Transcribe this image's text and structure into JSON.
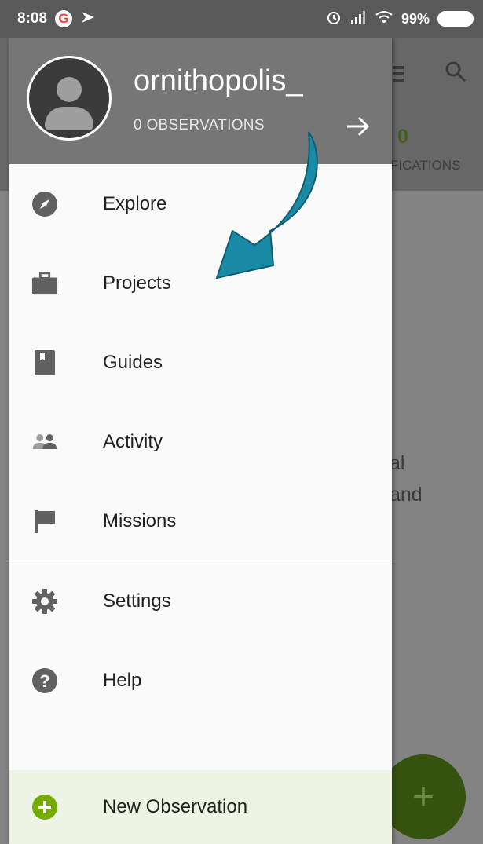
{
  "status_bar": {
    "time": "8:08",
    "g_badge": "G",
    "battery_pct": "99%"
  },
  "header": {
    "username": "ornithopolis_",
    "observations": "0 OBSERVATIONS"
  },
  "menu": [
    {
      "label": "Explore",
      "icon": "compass-icon"
    },
    {
      "label": "Projects",
      "icon": "briefcase-icon"
    },
    {
      "label": "Guides",
      "icon": "book-icon"
    },
    {
      "label": "Activity",
      "icon": "people-icon"
    },
    {
      "label": "Missions",
      "icon": "flag-icon"
    },
    {
      "label": "Settings",
      "icon": "gear-icon"
    },
    {
      "label": "Help",
      "icon": "help-icon"
    }
  ],
  "new_observation": {
    "label": "New Observation",
    "icon": "add-circle-icon"
  },
  "background": {
    "count": "0",
    "tab_label": "FICATIONS",
    "text_line1": "al",
    "text_line2": "and",
    "fab_symbol": "+"
  },
  "colors": {
    "accent_green": "#74ac00",
    "annotation_arrow": "#1a8aa6",
    "header_bg": "#767676"
  }
}
